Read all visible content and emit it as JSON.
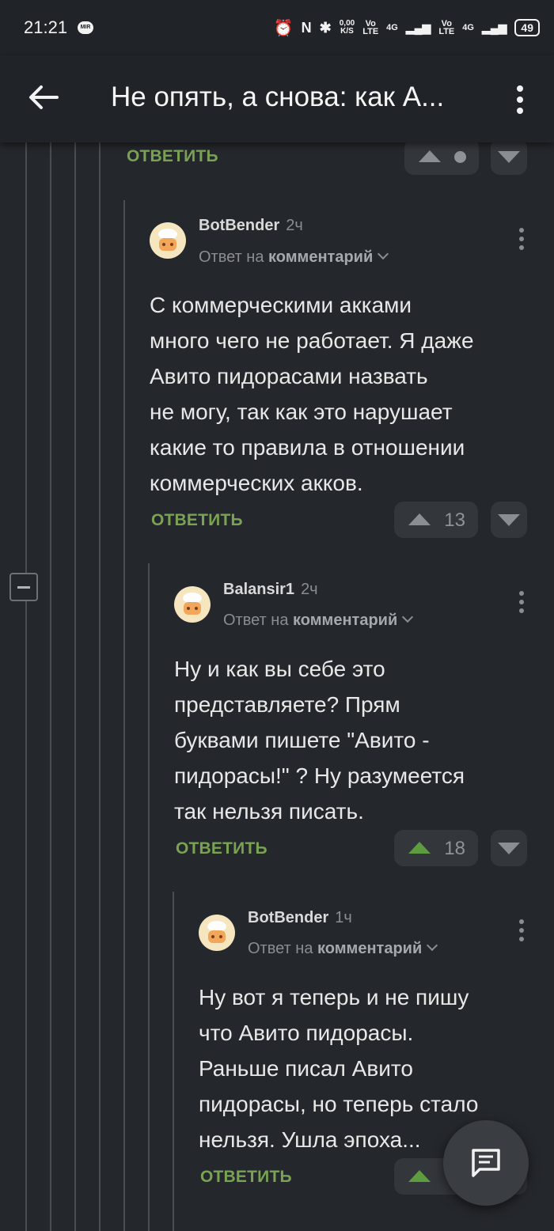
{
  "status_bar": {
    "time": "21:21",
    "mir_label": "MIR",
    "speed": "0,00\nK/S",
    "net1": "Vo\nLTE",
    "net1_gen": "4G",
    "net2": "Vo\nLTE",
    "net2_gen": "4G",
    "battery": "49"
  },
  "app_bar": {
    "title": "Не опять, а снова: как А..."
  },
  "reply_label": "ОТВЕТИТЬ",
  "top_fragment": {
    "reply_label": "ОТВЕТИТЬ"
  },
  "comments": [
    {
      "author": "BotBender",
      "age": "2ч",
      "reply_prefix": "Ответ на",
      "reply_target": "комментарий",
      "text": "С коммерческими акками\nмного чего не работает. Я даже\nАвито пидорасами назвать\nне могу, так как это нарушает\nкакие то правила в отношении\nкоммерческих акков.",
      "votes": "13",
      "reply_label": "ОТВЕТИТЬ"
    },
    {
      "author": "Balansir1",
      "age": "2ч",
      "reply_prefix": "Ответ на",
      "reply_target": "комментарий",
      "text": "Ну и как вы себе это\nпредставляете? Прям\nбуквами пишете \"Авито -\nпидорасы!\" ? Ну разумеется\nтак нельзя писать.",
      "votes": "18",
      "reply_label": "ОТВЕТИТЬ"
    },
    {
      "author": "BotBender",
      "age": "1ч",
      "reply_prefix": "Ответ на",
      "reply_target": "комментарий",
      "text": "Ну вот я теперь и не пишу\nчто Авито пидорасы.\nРаньше писал Авито\nпидорасы, но теперь стало\nнельзя. Ушла эпоха...",
      "reply_label": "ОТВЕТИТЬ"
    }
  ],
  "colors": {
    "background": "#24272c",
    "appbar": "#202327",
    "reply_green": "#7aa253",
    "vote_active": "#5e9d3f"
  },
  "icons": [
    "back-arrow-icon",
    "more-vert-icon",
    "chevron-down-icon",
    "arrow-up-icon",
    "arrow-down-icon",
    "comment-fab-icon",
    "alarm-icon",
    "nfc-icon",
    "bluetooth-icon"
  ]
}
